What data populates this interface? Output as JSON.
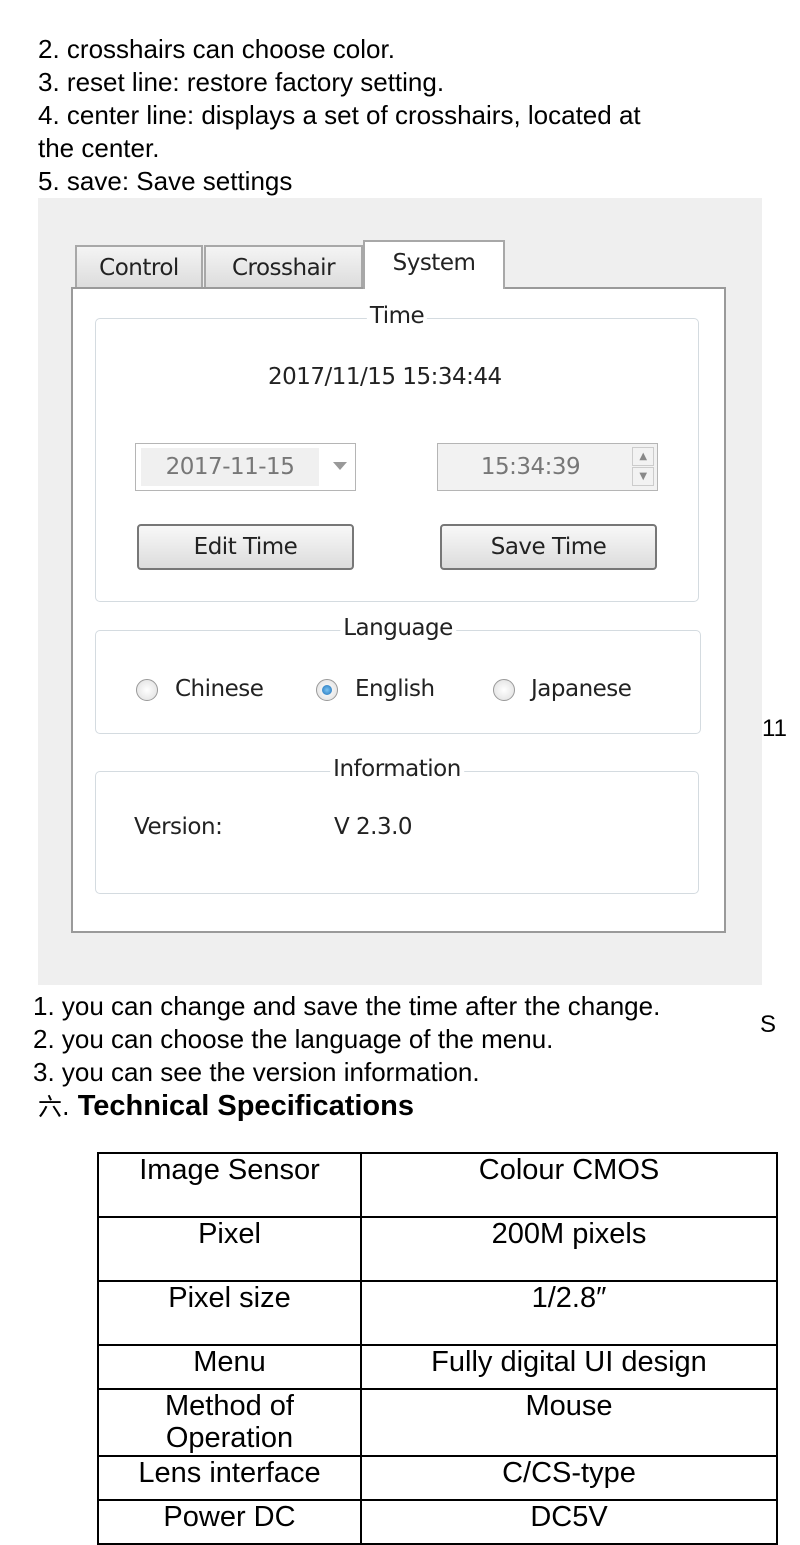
{
  "intro_lines": [
    "2. crosshairs    can choose color.",
    "3. reset line: restore factory setting.",
    "4. center line: displays a set of crosshairs, located at",
    "the center.",
    "5. save: Save settings"
  ],
  "ui": {
    "tabs": [
      {
        "label": "Control",
        "active": false
      },
      {
        "label": "Crosshair",
        "active": false
      },
      {
        "label": "System",
        "active": true
      }
    ],
    "time_group": {
      "legend": "Time",
      "current": "2017/11/15  15:34:44",
      "date_value": "2017-11-15",
      "time_value": "15:34:39",
      "edit_button": "Edit Time",
      "save_button": "Save Time"
    },
    "language_group": {
      "legend": "Language",
      "options": [
        {
          "label": "Chinese",
          "selected": false
        },
        {
          "label": "English",
          "selected": true
        },
        {
          "label": "Japanese",
          "selected": false
        }
      ]
    },
    "info_group": {
      "legend": "Information",
      "version_label": "Version:",
      "version_value": "V 2.3.0"
    }
  },
  "side_marks": {
    "page_number": "11",
    "s": "S"
  },
  "notes": [
    "1. you can change and save the time after the change.",
    "2. you can choose the language of the menu.",
    "3. you can see the version information."
  ],
  "heading": {
    "prefix": "六.",
    "title": "Technical Specifications"
  },
  "specs": [
    {
      "name": "Image Sensor",
      "value": "Colour CMOS"
    },
    {
      "name": "Pixel",
      "value": "200M pixels"
    },
    {
      "name": "Pixel size",
      "value": "1/2.8″"
    },
    {
      "name": "Menu",
      "value": "Fully digital UI design"
    },
    {
      "name": "Method of Operation",
      "value": "Mouse"
    },
    {
      "name": "Lens interface",
      "value": "C/CS-type"
    },
    {
      "name": "Power DC",
      "value": "DC5V"
    }
  ]
}
